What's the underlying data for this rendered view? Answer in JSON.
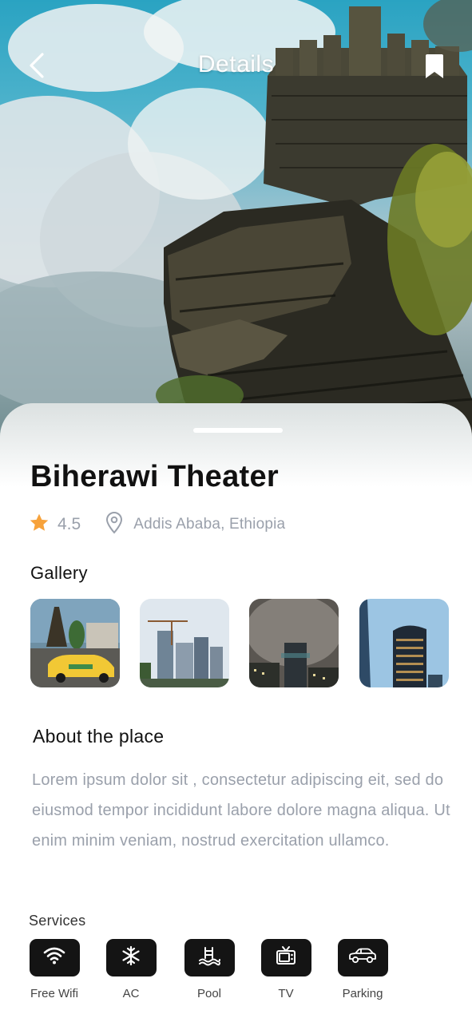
{
  "header": {
    "title": "Details",
    "back_icon": "chevron-left-icon",
    "bookmark_icon": "bookmark-icon"
  },
  "place": {
    "name": "Biherawi Theater",
    "rating": "4.5",
    "location": "Addis Ababa, Ethiopia"
  },
  "gallery": {
    "title": "Gallery",
    "images": [
      {
        "subject": "street-with-taxi"
      },
      {
        "subject": "city-skyline-cranes"
      },
      {
        "subject": "foggy-tower-night"
      },
      {
        "subject": "glass-skyscraper"
      }
    ]
  },
  "about": {
    "title": "About the place",
    "text": "Lorem ipsum dolor sit , consectetur adipiscing eit, sed do eiusmod tempor incididunt labore  dolore magna aliqua. Ut enim minim veniam, nostrud exercitation ullamco."
  },
  "services": {
    "title": "Services",
    "items": [
      {
        "label": "Free Wifi",
        "icon": "wifi-icon"
      },
      {
        "label": "AC",
        "icon": "snowflake-icon"
      },
      {
        "label": "Pool",
        "icon": "pool-icon"
      },
      {
        "label": "TV",
        "icon": "tv-icon"
      },
      {
        "label": "Parking",
        "icon": "car-icon"
      }
    ]
  },
  "colors": {
    "accent_star": "#f7a23b",
    "muted_text": "#9aa0ab",
    "service_bg": "#141414"
  }
}
